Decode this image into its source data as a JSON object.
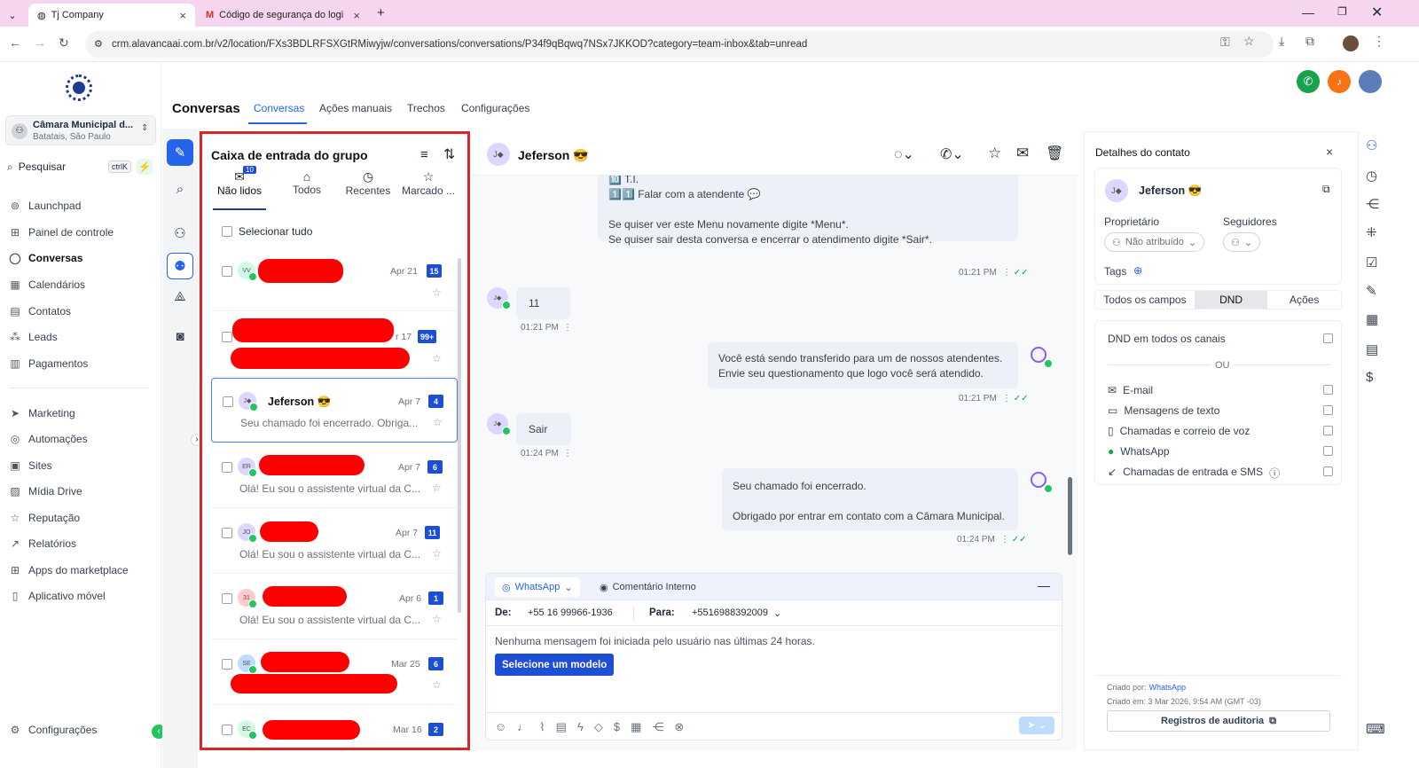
{
  "browser": {
    "tab1": "Tj Company",
    "tab2": "Código de segurança do login",
    "url": "crm.alavancaai.com.br/v2/location/FXs3BDLRFSXGtRMiwyjw/conversations/conversations/P34f9qBqwq7NSx7JKKOD?category=team-inbox&tab=unread"
  },
  "sidebar": {
    "loc_name": "Câmara Municipal d...",
    "loc_sub": "Batatais, São Paulo",
    "search": "Pesquisar",
    "search_key": "ctrlK",
    "items": [
      "Launchpad",
      "Painel de controle",
      "Conversas",
      "Calendários",
      "Contatos",
      "Leads",
      "Pagamentos"
    ],
    "items2": [
      "Marketing",
      "Automações",
      "Sites",
      "Mídia Drive",
      "Reputação",
      "Relatórios",
      "Apps do marketplace",
      "Aplicativo móvel"
    ],
    "settings": "Configurações"
  },
  "topnav": {
    "title": "Conversas",
    "tabs": [
      "Conversas",
      "Ações manuais",
      "Trechos",
      "Configurações"
    ]
  },
  "inbox": {
    "title": "Caixa de entrada do grupo",
    "tabs": [
      "Não lidos",
      "Todos",
      "Recentes",
      "Marcado ..."
    ],
    "unread_badge": "10",
    "select_all": "Selecionar tudo",
    "convs": [
      {
        "av": "VV",
        "date": "Apr 21",
        "count": "15",
        "name": "",
        "preview": ""
      },
      {
        "av": "",
        "date": "r 17",
        "count": "99+",
        "name": "",
        "preview": ""
      },
      {
        "av": "J◆",
        "date": "Apr 7",
        "count": "4",
        "name": "Jeferson 😎",
        "preview": "Seu chamado foi encerrado. Obriga..."
      },
      {
        "av": "ER",
        "date": "Apr 7",
        "count": "6",
        "name": "",
        "preview": "Olá! Eu sou o assistente virtual da C..."
      },
      {
        "av": "JO",
        "date": "Apr 7",
        "count": "11",
        "name": "",
        "preview": "Olá! Eu sou o assistente virtual da C..."
      },
      {
        "av": "31",
        "date": "Apr 6",
        "count": "1",
        "name": "",
        "preview": "Olá! Eu sou o assistente virtual da C..."
      },
      {
        "av": "SE",
        "date": "Mar 25",
        "count": "6",
        "name": "",
        "preview": ""
      },
      {
        "av": "EC",
        "date": "Mar 16",
        "count": "2",
        "name": "",
        "preview": ""
      }
    ]
  },
  "chat": {
    "contact": "Jeferson 😎",
    "contact_av": "J◆",
    "m1": [
      "🔟 T.I.",
      "1️⃣1️⃣ Falar com a atendente 💬",
      "",
      "Se quiser ver este Menu novamente digite *Menu*.",
      "Se quiser sair desta conversa e encerrar o atendimento digite *Sair*."
    ],
    "m1_time": "01:21 PM",
    "m2": "11",
    "m2_time": "01:21 PM",
    "m3": [
      "Você está sendo transferido para um de nossos atendentes.",
      "Envie seu questionamento que logo você será atendido."
    ],
    "m3_time": "01:21 PM",
    "m4": "Sair",
    "m4_time": "01:24 PM",
    "m5": [
      "Seu chamado foi encerrado.",
      "",
      "Obrigado por entrar em contato com a Câmara Municipal."
    ],
    "m5_time": "01:24 PM",
    "channel": "WhatsApp",
    "internal": "Comentário Interno",
    "from_label": "De:",
    "from": "+55 16 99966-1936",
    "to_label": "Para:",
    "to": "+5516988392009",
    "notice": "Nenhuma mensagem foi iniciada pelo usuário nas últimas 24 horas.",
    "template_btn": "Selecione um modelo"
  },
  "contact": {
    "header": "Detalhes do contato",
    "name": "Jeferson 😎",
    "owner_label": "Proprietário",
    "owner": "Não atribuído",
    "followers": "Seguidores",
    "tags": "Tags",
    "tabs": [
      "Todos os campos",
      "DND",
      "Ações"
    ],
    "dnd_all": "DND em todos os canais",
    "or": "OU",
    "channels": [
      "E-mail",
      "Mensagens de texto",
      "Chamadas e correio de voz",
      "WhatsApp",
      "Chamadas de entrada e SMS"
    ],
    "created_by_label": "Criado por:",
    "created_by": "WhatsApp",
    "created_at": "Criado em: 3 Mar 2026, 9:54 AM (GMT -03)",
    "audit": "Registros de auditoria"
  }
}
